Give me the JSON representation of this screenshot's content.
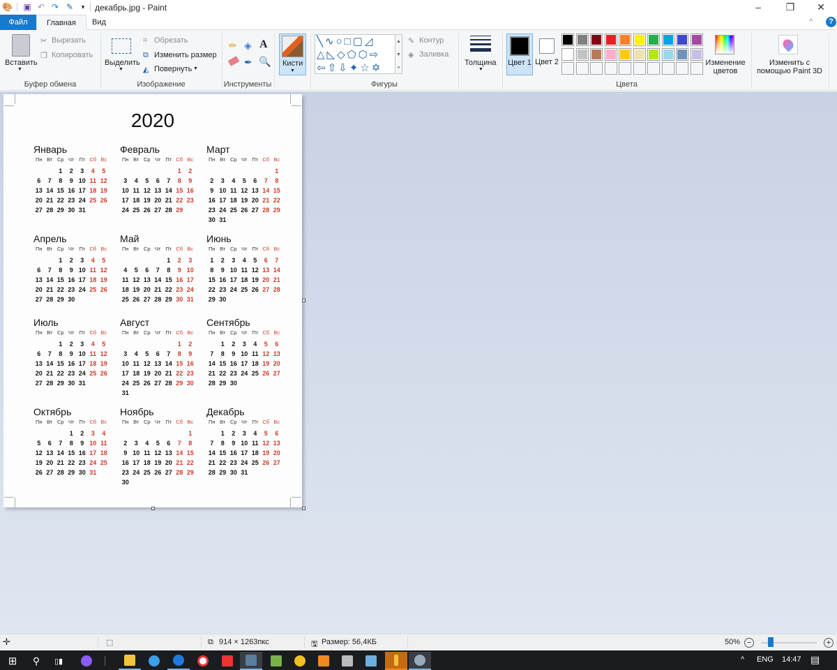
{
  "window": {
    "title": "декабрь.jpg - Paint",
    "minimize": "–",
    "restore": "❐",
    "close": "✕",
    "collapse_ribbon": "^",
    "help": "?"
  },
  "tabs": [
    {
      "label": "Файл"
    },
    {
      "label": "Главная"
    },
    {
      "label": "Вид"
    }
  ],
  "ribbon": {
    "clipboard": {
      "group": "Буфер обмена",
      "paste": "Вставить",
      "cut": "Вырезать",
      "copy": "Копировать"
    },
    "image": {
      "group": "Изображение",
      "select": "Выделить",
      "crop": "Обрезать",
      "resize": "Изменить размер",
      "rotate": "Повернуть"
    },
    "tools": {
      "group": "Инструменты"
    },
    "brushes": {
      "label": "Кисти"
    },
    "shapes": {
      "group": "Фигуры",
      "outline": "Контур",
      "fill": "Заливка"
    },
    "size": {
      "label": "Толщина"
    },
    "colors": {
      "group": "Цвета",
      "color1": "Цвет 1",
      "color2": "Цвет 2",
      "edit": "Изменение цветов",
      "color1_value": "#000000",
      "color2_value": "#ffffff",
      "palette": [
        [
          "#000000",
          "#7f7f7f",
          "#880015",
          "#ed1c24",
          "#ff7f27",
          "#fff200",
          "#22b14c",
          "#00a2e8",
          "#3f48cc",
          "#a349a4"
        ],
        [
          "#ffffff",
          "#c3c3c3",
          "#b97a57",
          "#ffaec9",
          "#ffc90e",
          "#efe4b0",
          "#b5e61d",
          "#99d9ea",
          "#7092be",
          "#c8bfe7"
        ],
        [
          "",
          "",
          "",
          "",
          "",
          "",
          "",
          "",
          "",
          ""
        ]
      ]
    },
    "paint3d": {
      "label": "Изменить с помощью Paint 3D"
    }
  },
  "calendar": {
    "year": "2020",
    "weekdays": [
      "Пн",
      "Вт",
      "Ср",
      "Чт",
      "Пт",
      "Сб",
      "Вс"
    ],
    "weekend_color": "#d03a2a",
    "months": [
      {
        "name": "Январь",
        "weeks": [
          [
            "",
            "",
            "1",
            "2",
            "3",
            "4",
            "5"
          ],
          [
            "6",
            "7",
            "8",
            "9",
            "10",
            "11",
            "12"
          ],
          [
            "13",
            "14",
            "15",
            "16",
            "17",
            "18",
            "19"
          ],
          [
            "20",
            "21",
            "22",
            "23",
            "24",
            "25",
            "26"
          ],
          [
            "27",
            "28",
            "29",
            "30",
            "31",
            "",
            ""
          ]
        ]
      },
      {
        "name": "Февраль",
        "weeks": [
          [
            "",
            "",
            "",
            "",
            "",
            "1",
            "2"
          ],
          [
            "3",
            "4",
            "5",
            "6",
            "7",
            "8",
            "9"
          ],
          [
            "10",
            "11",
            "12",
            "13",
            "14",
            "15",
            "16"
          ],
          [
            "17",
            "18",
            "19",
            "20",
            "21",
            "22",
            "23"
          ],
          [
            "24",
            "25",
            "26",
            "27",
            "28",
            "29",
            ""
          ]
        ]
      },
      {
        "name": "Март",
        "weeks": [
          [
            "",
            "",
            "",
            "",
            "",
            "",
            "1"
          ],
          [
            "2",
            "3",
            "4",
            "5",
            "6",
            "7",
            "8"
          ],
          [
            "9",
            "10",
            "11",
            "12",
            "13",
            "14",
            "15"
          ],
          [
            "16",
            "17",
            "18",
            "19",
            "20",
            "21",
            "22"
          ],
          [
            "23",
            "24",
            "25",
            "26",
            "27",
            "28",
            "29"
          ],
          [
            "30",
            "31",
            "",
            "",
            "",
            "",
            ""
          ]
        ]
      },
      {
        "name": "Апрель",
        "weeks": [
          [
            "",
            "",
            "1",
            "2",
            "3",
            "4",
            "5"
          ],
          [
            "6",
            "7",
            "8",
            "9",
            "10",
            "11",
            "12"
          ],
          [
            "13",
            "14",
            "15",
            "16",
            "17",
            "18",
            "19"
          ],
          [
            "20",
            "21",
            "22",
            "23",
            "24",
            "25",
            "26"
          ],
          [
            "27",
            "28",
            "29",
            "30",
            "",
            "",
            ""
          ]
        ]
      },
      {
        "name": "Май",
        "weeks": [
          [
            "",
            "",
            "",
            "",
            "1",
            "2",
            "3"
          ],
          [
            "4",
            "5",
            "6",
            "7",
            "8",
            "9",
            "10"
          ],
          [
            "11",
            "12",
            "13",
            "14",
            "15",
            "16",
            "17"
          ],
          [
            "18",
            "19",
            "20",
            "21",
            "22",
            "23",
            "24"
          ],
          [
            "25",
            "26",
            "27",
            "28",
            "29",
            "30",
            "31"
          ]
        ]
      },
      {
        "name": "Июнь",
        "weeks": [
          [
            "1",
            "2",
            "3",
            "4",
            "5",
            "6",
            "7"
          ],
          [
            "8",
            "9",
            "10",
            "11",
            "12",
            "13",
            "14"
          ],
          [
            "15",
            "16",
            "17",
            "18",
            "19",
            "20",
            "21"
          ],
          [
            "22",
            "23",
            "24",
            "25",
            "26",
            "27",
            "28"
          ],
          [
            "29",
            "30",
            "",
            "",
            "",
            "",
            ""
          ]
        ]
      },
      {
        "name": "Июль",
        "weeks": [
          [
            "",
            "",
            "1",
            "2",
            "3",
            "4",
            "5"
          ],
          [
            "6",
            "7",
            "8",
            "9",
            "10",
            "11",
            "12"
          ],
          [
            "13",
            "14",
            "15",
            "16",
            "17",
            "18",
            "19"
          ],
          [
            "20",
            "21",
            "22",
            "23",
            "24",
            "25",
            "26"
          ],
          [
            "27",
            "28",
            "29",
            "30",
            "31",
            "",
            ""
          ]
        ]
      },
      {
        "name": "Август",
        "weeks": [
          [
            "",
            "",
            "",
            "",
            "",
            "1",
            "2"
          ],
          [
            "3",
            "4",
            "5",
            "6",
            "7",
            "8",
            "9"
          ],
          [
            "10",
            "11",
            "12",
            "13",
            "14",
            "15",
            "16"
          ],
          [
            "17",
            "18",
            "19",
            "20",
            "21",
            "22",
            "23"
          ],
          [
            "24",
            "25",
            "26",
            "27",
            "28",
            "29",
            "30"
          ],
          [
            "31",
            "",
            "",
            "",
            "",
            "",
            ""
          ]
        ]
      },
      {
        "name": "Сентябрь",
        "weeks": [
          [
            "",
            "1",
            "2",
            "3",
            "4",
            "5",
            "6"
          ],
          [
            "7",
            "8",
            "9",
            "10",
            "11",
            "12",
            "13"
          ],
          [
            "14",
            "15",
            "16",
            "17",
            "18",
            "19",
            "20"
          ],
          [
            "21",
            "22",
            "23",
            "24",
            "25",
            "26",
            "27"
          ],
          [
            "28",
            "29",
            "30",
            "",
            "",
            "",
            ""
          ]
        ]
      },
      {
        "name": "Октябрь",
        "weeks": [
          [
            "",
            "",
            "",
            "1",
            "2",
            "3",
            "4"
          ],
          [
            "5",
            "6",
            "7",
            "8",
            "9",
            "10",
            "11"
          ],
          [
            "12",
            "13",
            "14",
            "15",
            "16",
            "17",
            "18"
          ],
          [
            "19",
            "20",
            "21",
            "22",
            "23",
            "24",
            "25"
          ],
          [
            "26",
            "27",
            "28",
            "29",
            "30",
            "31",
            ""
          ]
        ]
      },
      {
        "name": "Ноябрь",
        "weeks": [
          [
            "",
            "",
            "",
            "",
            "",
            "",
            "1"
          ],
          [
            "2",
            "3",
            "4",
            "5",
            "6",
            "7",
            "8"
          ],
          [
            "9",
            "10",
            "11",
            "12",
            "13",
            "14",
            "15"
          ],
          [
            "16",
            "17",
            "18",
            "19",
            "20",
            "21",
            "22"
          ],
          [
            "23",
            "24",
            "25",
            "26",
            "27",
            "28",
            "29"
          ],
          [
            "30",
            "",
            "",
            "",
            "",
            "",
            ""
          ]
        ]
      },
      {
        "name": "Декабрь",
        "weeks": [
          [
            "",
            "1",
            "2",
            "3",
            "4",
            "5",
            "6"
          ],
          [
            "7",
            "8",
            "9",
            "10",
            "11",
            "12",
            "13"
          ],
          [
            "14",
            "15",
            "16",
            "17",
            "18",
            "19",
            "20"
          ],
          [
            "21",
            "22",
            "23",
            "24",
            "25",
            "26",
            "27"
          ],
          [
            "28",
            "29",
            "30",
            "31",
            "",
            "",
            ""
          ]
        ]
      }
    ]
  },
  "statusbar": {
    "dimensions": "914 × 1263пкс",
    "size": "Размер: 56,4КБ",
    "zoom": "50%",
    "zoom_level_percent": 50
  },
  "taskbar": {
    "lang": "ENG",
    "time": "14:47"
  }
}
